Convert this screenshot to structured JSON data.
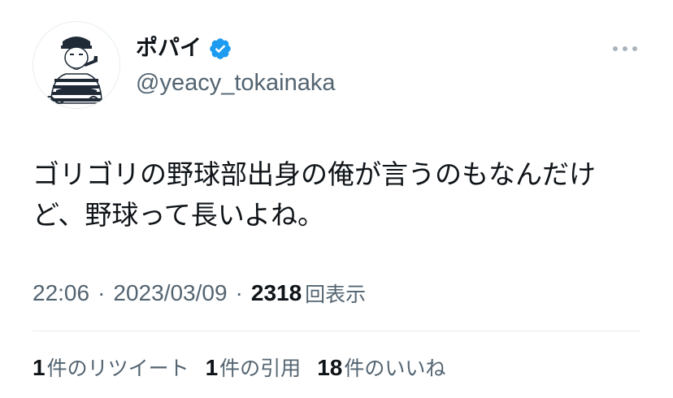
{
  "user": {
    "display_name": "ポパイ",
    "handle": "@yeacy_tokainaka",
    "verified": true,
    "avatar_icon": "sailor-portrait-icon"
  },
  "menu": {
    "icon": "more-horizontal-icon"
  },
  "tweet": {
    "text": "ゴリゴリの野球部出身の俺が言うのもなんだけ\nど、野球って長いよね。"
  },
  "meta": {
    "time": "22:06",
    "separator": "·",
    "date": "2023/03/09",
    "views_count": "2318",
    "views_label": "回表示"
  },
  "stats": {
    "retweets_count": "1",
    "retweets_label": "件のリツイート",
    "quotes_count": "1",
    "quotes_label": "件の引用",
    "likes_count": "18",
    "likes_label": "件のいいね"
  },
  "colors": {
    "text_primary": "#0f1419",
    "text_secondary": "#536471",
    "verified_blue": "#1d9bf0",
    "divider": "#e6ecf0"
  }
}
